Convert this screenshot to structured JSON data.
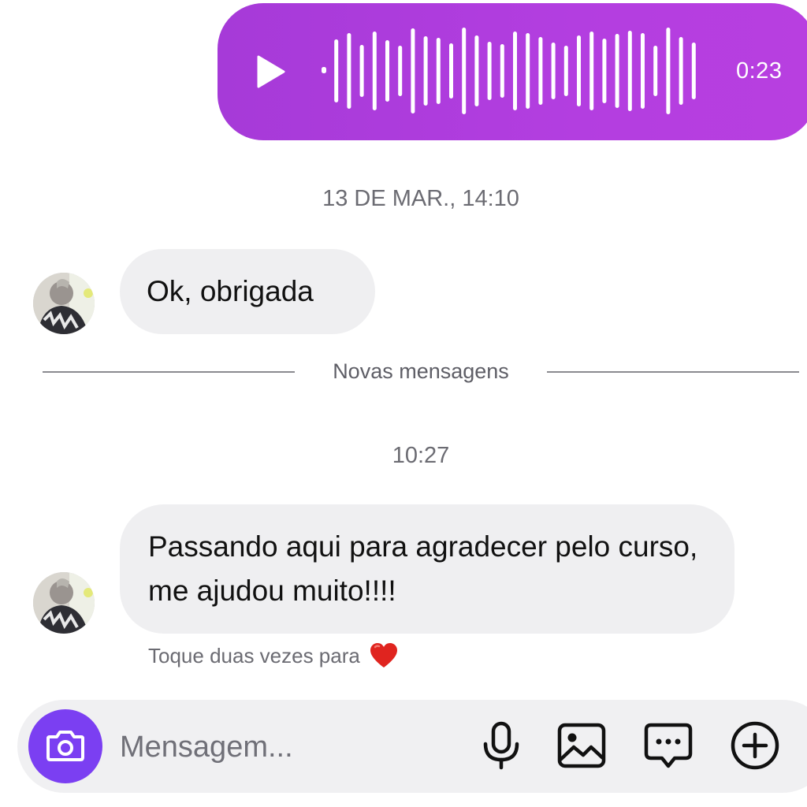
{
  "voice_message": {
    "duration": "0:23",
    "bubble_color": "#b13de0",
    "icon": "play-icon"
  },
  "timestamps": {
    "first": "13 DE MAR., 14:10",
    "second": "10:27"
  },
  "messages": [
    {
      "text": "Ok, obrigada",
      "direction": "incoming"
    },
    {
      "text": "Passando aqui para agradecer pelo curso, me ajudou muito!!!!",
      "direction": "incoming"
    }
  ],
  "divider": {
    "label": "Novas mensagens"
  },
  "hint": {
    "text": "Toque duas vezes para",
    "icon": "heart-icon"
  },
  "composer": {
    "placeholder": "Mensagem...",
    "accent_color": "#7b3ff2",
    "icons": [
      "camera-icon",
      "microphone-icon",
      "gallery-icon",
      "sticker-icon",
      "plus-icon"
    ]
  }
}
